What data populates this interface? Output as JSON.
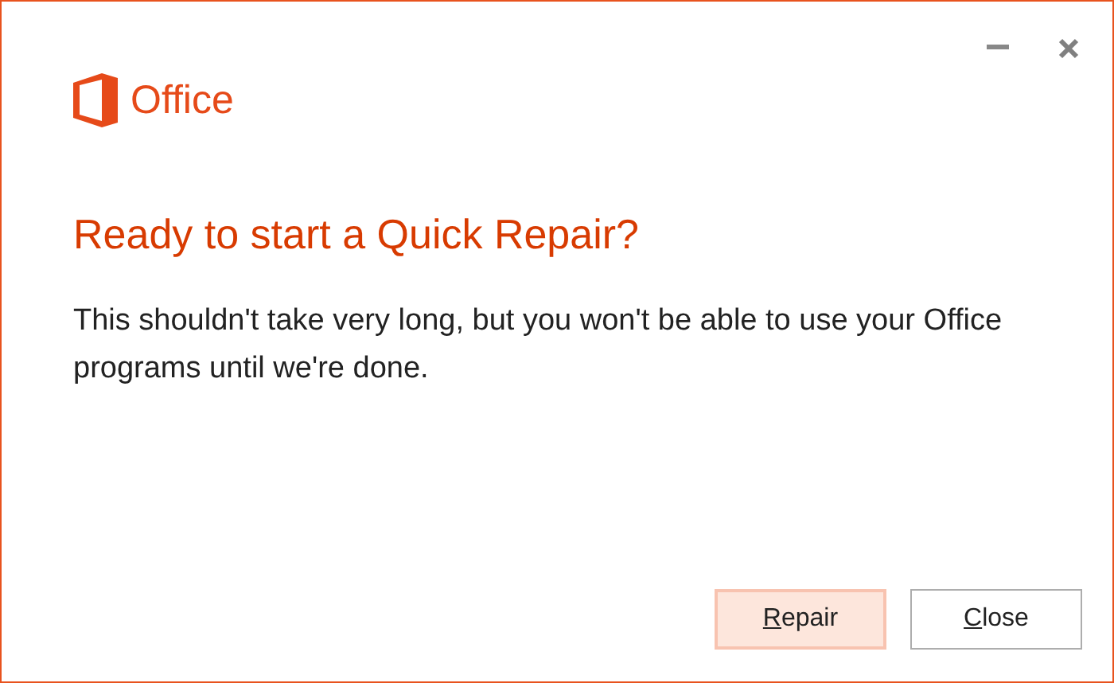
{
  "window": {
    "logo_text": "Office"
  },
  "heading": "Ready to start a Quick Repair?",
  "message": "This shouldn't take very long, but you won't be able to use your Office programs until we're done.",
  "buttons": [
    {
      "label": "Repair",
      "default": true
    },
    {
      "label": "Close",
      "default": false
    }
  ]
}
